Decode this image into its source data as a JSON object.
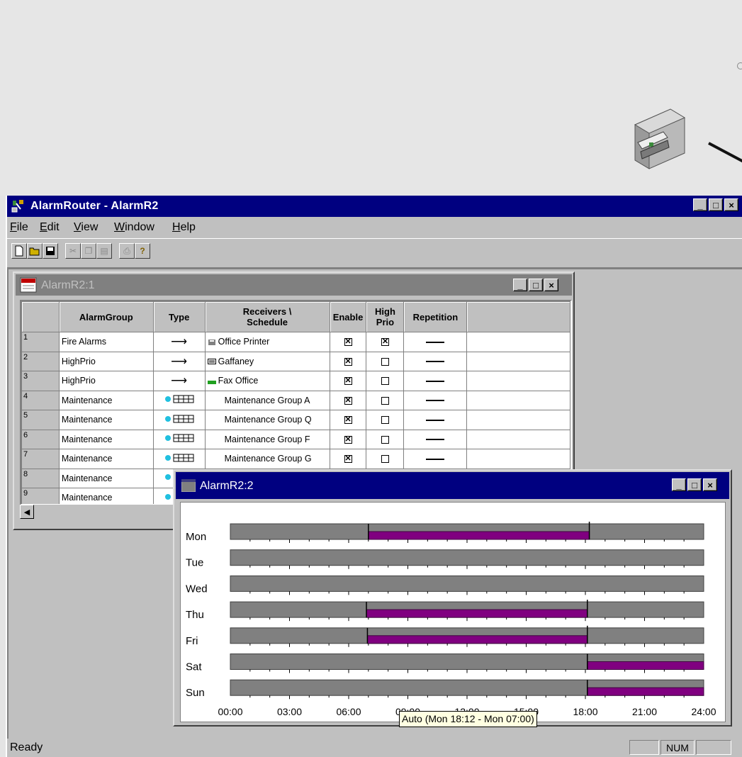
{
  "app": {
    "title": "AlarmRouter - AlarmR2",
    "menu": [
      "File",
      "Edit",
      "View",
      "Window",
      "Help"
    ],
    "status": {
      "ready": "Ready",
      "num": "NUM"
    }
  },
  "child1": {
    "title": "AlarmR2:1",
    "columns": [
      "",
      "AlarmGroup",
      "Type",
      "Receivers \\ Schedule",
      "Enable",
      "High Prio",
      "Repetition",
      ""
    ],
    "rows": [
      {
        "n": "1",
        "group": "Fire Alarms",
        "type": "arrow",
        "receiver": "Office Printer",
        "ricon": "printer",
        "enable": true,
        "high": true,
        "rep": true
      },
      {
        "n": "2",
        "group": "HighPrio",
        "type": "arrow",
        "receiver": "Gaffaney",
        "ricon": "pager",
        "enable": true,
        "high": false,
        "rep": true
      },
      {
        "n": "3",
        "group": "HighPrio",
        "type": "arrow",
        "receiver": "Fax Office",
        "ricon": "fax",
        "enable": true,
        "high": false,
        "rep": true
      },
      {
        "n": "4",
        "group": "Maintenance",
        "type": "schedule",
        "receiver": "Maintenance Group A",
        "ricon": "",
        "enable": true,
        "high": false,
        "rep": true
      },
      {
        "n": "5",
        "group": "Maintenance",
        "type": "schedule",
        "receiver": "Maintenance Group Q",
        "ricon": "",
        "enable": true,
        "high": false,
        "rep": true
      },
      {
        "n": "6",
        "group": "Maintenance",
        "type": "schedule",
        "receiver": "Maintenance Group F",
        "ricon": "",
        "enable": true,
        "high": false,
        "rep": true
      },
      {
        "n": "7",
        "group": "Maintenance",
        "type": "schedule",
        "receiver": "Maintenance Group G",
        "ricon": "",
        "enable": true,
        "high": false,
        "rep": true
      },
      {
        "n": "8",
        "group": "Maintenance",
        "type": "schedule",
        "receiver": "",
        "ricon": "",
        "enable": null,
        "high": null,
        "rep": false
      },
      {
        "n": "9",
        "group": "Maintenance",
        "type": "schedule",
        "receiver": "",
        "ricon": "",
        "enable": null,
        "high": null,
        "rep": false
      }
    ]
  },
  "child2": {
    "title": "AlarmR2:2",
    "days": [
      "Mon",
      "Tue",
      "Wed",
      "Thu",
      "Fri",
      "Sat",
      "Sun"
    ],
    "hour_labels": [
      "00:00",
      "03:00",
      "06:00",
      "09:00",
      "12:00",
      "15:00",
      "18:00",
      "21:00",
      "24:00"
    ],
    "active_hours": [
      [
        7.0,
        18.2
      ],
      [],
      [],
      [
        6.9,
        18.1
      ],
      [
        6.95,
        18.1
      ],
      [
        18.1,
        24
      ],
      [
        18.1,
        24
      ]
    ],
    "colors": {
      "inactive": "#808080",
      "active": "#800080"
    },
    "tooltip": "Auto (Mon 18:12 - Mon 07:00)"
  }
}
